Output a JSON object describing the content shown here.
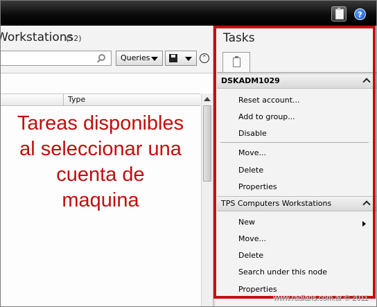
{
  "toolbar": {
    "help_symbol": "?",
    "clipboard_icon": "clipboard-icon",
    "help_icon": "help-icon"
  },
  "left_pane": {
    "title": "Workstations",
    "count": "(52)",
    "search": {
      "value": "",
      "placeholder": ""
    },
    "queries_label": "Queries",
    "collapse_symbol": "⌃",
    "columns": [
      {
        "label": ""
      },
      {
        "label": "Type"
      }
    ]
  },
  "annotation": {
    "lines": [
      "Tareas disponibles",
      "al seleccionar una",
      "cuenta de",
      "maquina"
    ],
    "color": "#c20d0d"
  },
  "tasks_pane": {
    "title": "Tasks",
    "sections": [
      {
        "header": "DSKADM1029",
        "items": [
          "Reset account...",
          "Add to group...",
          "Disable",
          "Move...",
          "Delete",
          "Properties"
        ]
      },
      {
        "header": "TPS Computers Workstations",
        "items": [
          "New",
          "Move...",
          "Delete",
          "Search under this node",
          "Properties"
        ]
      }
    ]
  },
  "highlight_color": "#c41010",
  "watermark": "www.radians.com.ar © 2011"
}
